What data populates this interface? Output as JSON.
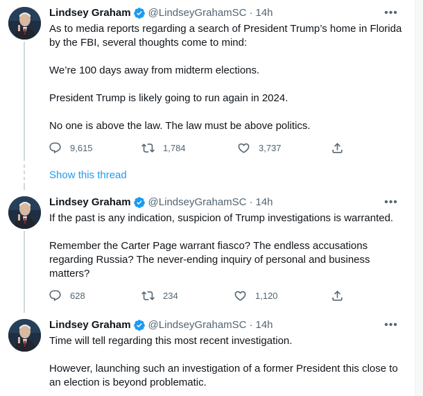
{
  "author": {
    "name": "Lindsey Graham",
    "handle": "@LindseyGrahamSC",
    "separator": "·"
  },
  "more_label": "•••",
  "show_thread_label": "Show this thread",
  "accent_color": "#1d9bf0",
  "icons": {
    "verified": "verified-badge-icon",
    "reply": "reply-icon",
    "retweet": "retweet-icon",
    "like": "like-icon",
    "share": "share-icon",
    "more": "more-icon"
  },
  "tweets": [
    {
      "time": "14h",
      "paragraphs": [
        "As to media reports regarding a search of President Trump’s home in Florida by the FBI, several thoughts come to mind:",
        "We’re 100 days away from midterm elections.",
        "President Trump is likely going to run again in 2024.",
        "No one is above the law. The law must be above politics."
      ],
      "replies": "9,615",
      "retweets": "1,784",
      "likes": "3,737"
    },
    {
      "time": "14h",
      "paragraphs": [
        "If the past is any indication, suspicion of Trump investigations is warranted.",
        "Remember the Carter Page warrant fiasco? The endless accusations regarding Russia? The never-ending inquiry of personal and business matters?"
      ],
      "replies": "628",
      "retweets": "234",
      "likes": "1,120"
    },
    {
      "time": "14h",
      "paragraphs": [
        "Time will tell regarding this most recent investigation.",
        "However, launching such an investigation of a former President this close to an election is beyond problematic."
      ]
    }
  ]
}
